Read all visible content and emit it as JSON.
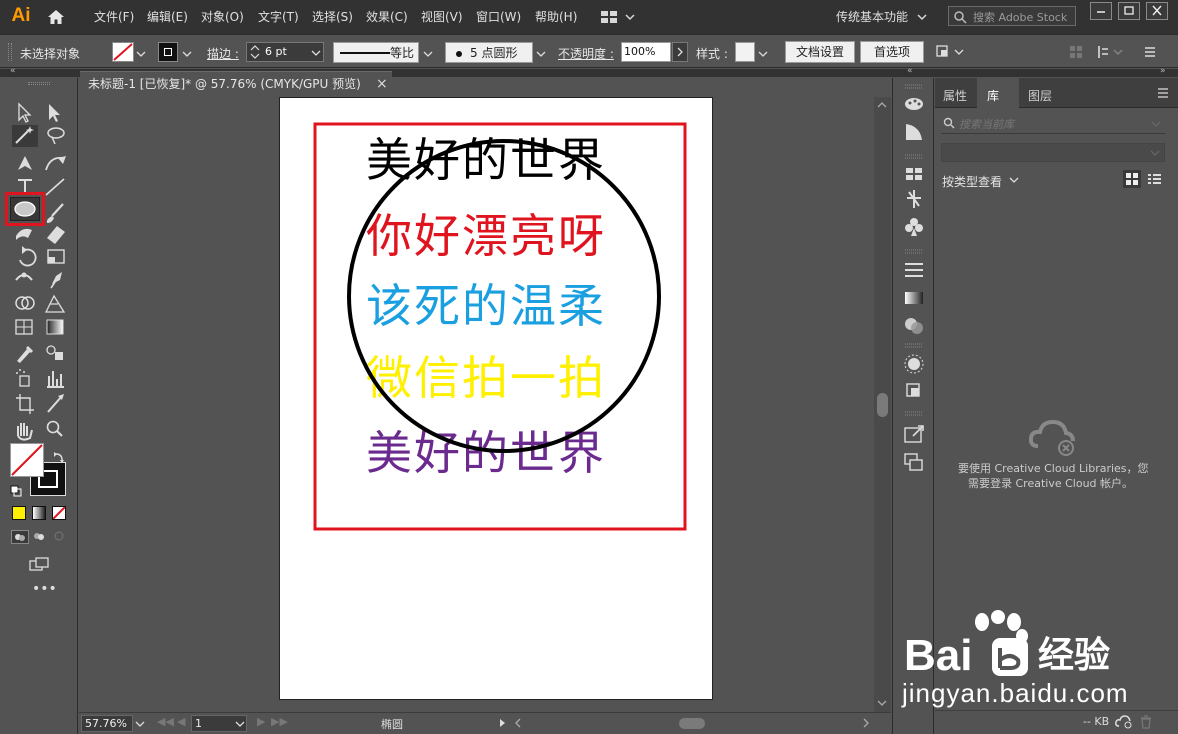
{
  "app": {
    "logo_text": "Ai",
    "brand_color": "#ff9a00"
  },
  "menu": {
    "items": [
      "文件(F)",
      "编辑(E)",
      "对象(O)",
      "文字(T)",
      "选择(S)",
      "效果(C)",
      "视图(V)",
      "窗口(W)",
      "帮助(H)"
    ],
    "workspace": "传统基本功能",
    "search_placeholder": "搜索 Adobe Stock"
  },
  "control_bar": {
    "selection_status": "未选择对象",
    "stroke_label": "描边 :",
    "stroke_value": "6 pt",
    "profile_label": "等比",
    "brush_label": "5 点圆形",
    "opacity_label": "不透明度 :",
    "opacity_value": "100%",
    "style_label": "样式 :",
    "doc_setup_button": "文档设置",
    "preferences_button": "首选项"
  },
  "document": {
    "tab_title": "未标题-1 [已恢复]* @ 57.76% (CMYK/GPU 预览)",
    "close_glyph": "×"
  },
  "artwork": {
    "lines": [
      {
        "text": "美好的世界",
        "color": "#000000"
      },
      {
        "text": "你好漂亮呀",
        "color": "#e0141e"
      },
      {
        "text": "该死的温柔",
        "color": "#1a9fe0"
      },
      {
        "text": "微信拍一拍",
        "color": "#fff000"
      },
      {
        "text": "美好的世界",
        "color": "#6b2a8e"
      }
    ],
    "frame_color": "#e0141e",
    "circle_color": "#000000"
  },
  "statusbar": {
    "zoom": "57.76%",
    "artboard_number": "1",
    "current_tool": "椭圆"
  },
  "right_panel": {
    "tabs": [
      "属性",
      "库",
      "图层"
    ],
    "active_tab": "库",
    "search_placeholder": "搜索当前库",
    "view_by_label": "按类型查看",
    "cc_message_line1": "要使用 Creative Cloud Libraries，您",
    "cc_message_line2": "需要登录 Creative Cloud 帐户。",
    "footer_size": "-- KB"
  },
  "watermark": {
    "brand": "Bai",
    "brand2": "经验",
    "url": "jingyan.baidu.com"
  },
  "colors": {
    "highlight": "#e0141e",
    "fill_swatch": "#fff000"
  }
}
